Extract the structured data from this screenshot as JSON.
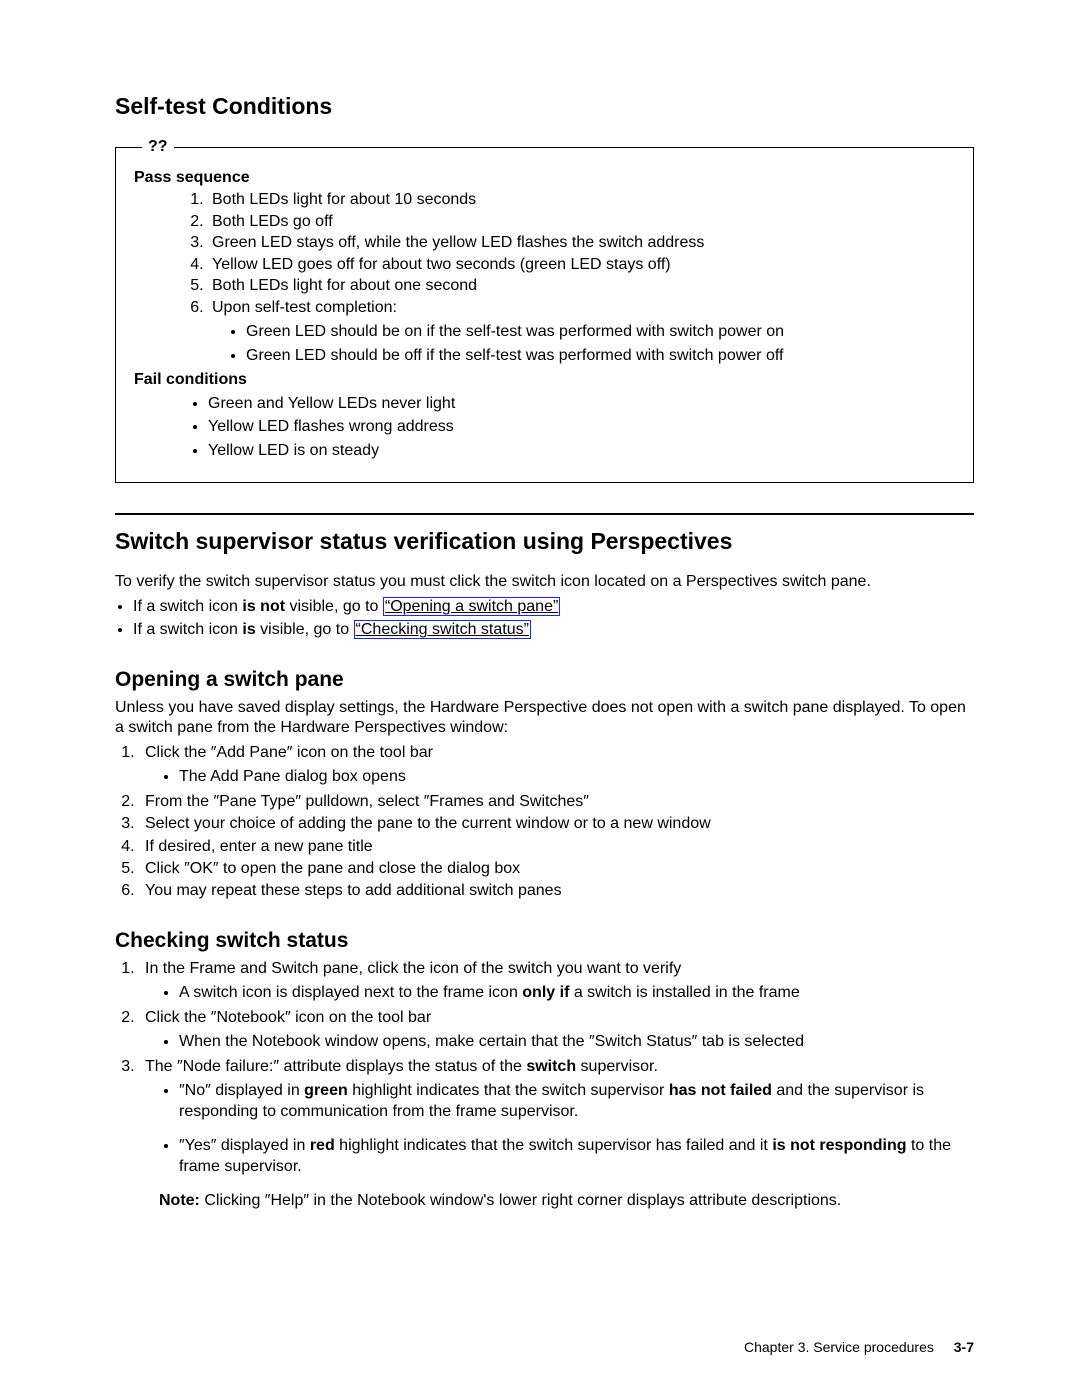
{
  "selftest": {
    "heading": "Self-test Conditions",
    "legend": "??",
    "pass_label": "Pass sequence",
    "pass_steps": [
      "Both LEDs light for about 10 seconds",
      "Both LEDs go off",
      "Green LED stays off, while the yellow LED flashes the switch address",
      "Yellow LED goes off for about two seconds (green LED stays off)",
      "Both LEDs light for about one second",
      "Upon self-test completion:"
    ],
    "pass_sub": [
      "Green LED should be on if the self-test was performed with switch power on",
      "Green LED should be off if the self-test was performed with switch power off"
    ],
    "fail_label": "Fail conditions",
    "fail_items": [
      "Green and Yellow LEDs never light",
      "Yellow LED flashes wrong address",
      "Yellow LED is on steady"
    ]
  },
  "verify": {
    "heading": "Switch supervisor status verification using Perspectives",
    "intro": "To verify the switch supervisor status you must click the switch icon located on a Perspectives switch pane.",
    "b1_pre": "If a switch icon ",
    "b1_bold": "is not",
    "b1_mid": " visible, go to ",
    "b1_link": "“Opening a switch pane”",
    "b2_pre": "If a switch icon ",
    "b2_bold": "is",
    "b2_mid": " visible, go to ",
    "b2_link": "“Checking switch status”"
  },
  "opening": {
    "heading": "Opening a switch pane",
    "intro": "Unless you have saved display settings, the Hardware Perspective does not open with a switch pane displayed. To open a switch pane from the Hardware Perspectives window:",
    "steps": [
      "Click the ″Add Pane″ icon on the tool bar",
      "From the ″Pane Type″ pulldown, select ″Frames and Switches″",
      "Select your choice of adding the pane to the current window or to a new window",
      "If desired, enter a new pane title",
      "Click ″OK″ to open the pane and close the dialog box",
      "You may repeat these steps to add additional switch panes"
    ],
    "step1_sub": "The Add Pane dialog box opens"
  },
  "checking": {
    "heading": "Checking switch status",
    "s1": "In the Frame and Switch pane, click the icon of the switch you want to verify",
    "s1_sub_pre": "A switch icon is displayed next to the frame icon ",
    "s1_sub_bold": "only if",
    "s1_sub_post": " a switch is installed in the frame",
    "s2": "Click the ″Notebook″ icon on the tool bar",
    "s2_sub": "When the Notebook window opens, make certain that the ″Switch Status″ tab is selected",
    "s3_pre": "The ″Node failure:″ attribute displays the status of the ",
    "s3_bold": "switch",
    "s3_post": " supervisor.",
    "s3_no_pre": "″No″ displayed in ",
    "s3_no_color": "green",
    "s3_no_mid": " highlight indicates that the switch supervisor ",
    "s3_no_bold": "has not failed",
    "s3_no_post": " and the supervisor is responding to communication from the frame supervisor.",
    "s3_yes_pre": "″Yes″ displayed in ",
    "s3_yes_color": "red",
    "s3_yes_mid": " highlight indicates that the switch supervisor has failed and it ",
    "s3_yes_bold": "is not responding",
    "s3_yes_post": " to the frame supervisor.",
    "note_label": "Note:",
    "note_text": " Clicking ″Help″ in the Notebook window's lower right corner displays attribute descriptions."
  },
  "footer": {
    "chapter": "Chapter 3. Service procedures",
    "page": "3-7"
  }
}
